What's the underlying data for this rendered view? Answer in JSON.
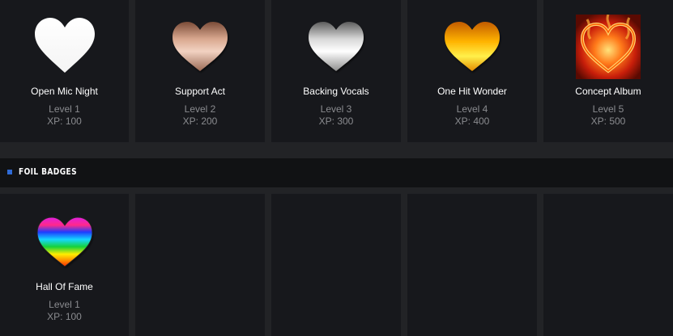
{
  "badges": [
    {
      "name": "Open Mic Night",
      "level": "Level 1",
      "xp": "XP: 100",
      "icon": "white-heart-icon"
    },
    {
      "name": "Support Act",
      "level": "Level 2",
      "xp": "XP: 200",
      "icon": "bronze-heart-icon"
    },
    {
      "name": "Backing Vocals",
      "level": "Level 3",
      "xp": "XP: 300",
      "icon": "silver-heart-icon"
    },
    {
      "name": "One Hit Wonder",
      "level": "Level 4",
      "xp": "XP: 400",
      "icon": "gold-heart-icon"
    },
    {
      "name": "Concept Album",
      "level": "Level 5",
      "xp": "XP: 500",
      "icon": "flaming-heart-icon"
    }
  ],
  "foil_section": {
    "title": "FOIL BADGES",
    "badges": [
      {
        "name": "Hall Of Fame",
        "level": "Level 1",
        "xp": "XP: 100",
        "icon": "rainbow-heart-icon"
      }
    ]
  },
  "colors": {
    "page_bg": "#222326",
    "card_bg": "#17181c",
    "header_bg": "#111214",
    "bullet": "#2f6bd6",
    "muted_text": "#8a8b8f"
  }
}
